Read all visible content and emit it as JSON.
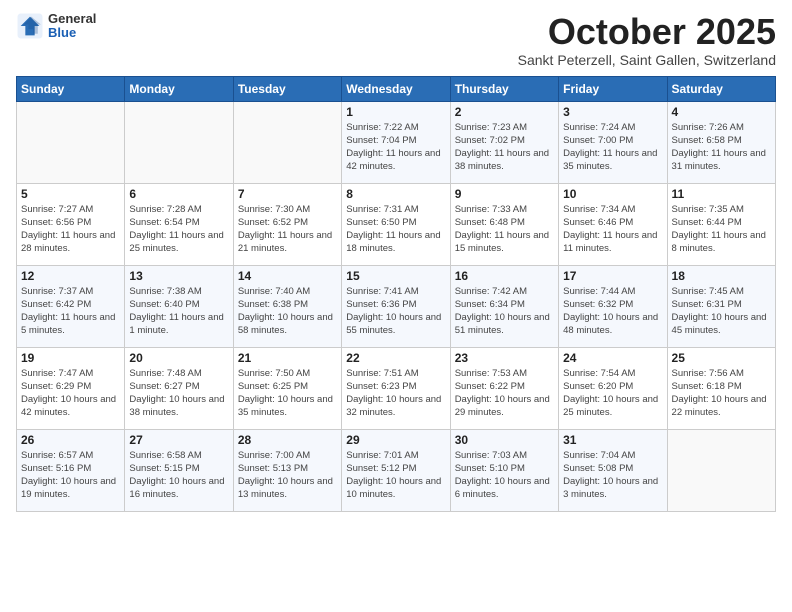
{
  "header": {
    "logo_general": "General",
    "logo_blue": "Blue",
    "month_title": "October 2025",
    "location": "Sankt Peterzell, Saint Gallen, Switzerland"
  },
  "days_of_week": [
    "Sunday",
    "Monday",
    "Tuesday",
    "Wednesday",
    "Thursday",
    "Friday",
    "Saturday"
  ],
  "weeks": [
    [
      {
        "day": "",
        "info": ""
      },
      {
        "day": "",
        "info": ""
      },
      {
        "day": "",
        "info": ""
      },
      {
        "day": "1",
        "info": "Sunrise: 7:22 AM\nSunset: 7:04 PM\nDaylight: 11 hours and 42 minutes."
      },
      {
        "day": "2",
        "info": "Sunrise: 7:23 AM\nSunset: 7:02 PM\nDaylight: 11 hours and 38 minutes."
      },
      {
        "day": "3",
        "info": "Sunrise: 7:24 AM\nSunset: 7:00 PM\nDaylight: 11 hours and 35 minutes."
      },
      {
        "day": "4",
        "info": "Sunrise: 7:26 AM\nSunset: 6:58 PM\nDaylight: 11 hours and 31 minutes."
      }
    ],
    [
      {
        "day": "5",
        "info": "Sunrise: 7:27 AM\nSunset: 6:56 PM\nDaylight: 11 hours and 28 minutes."
      },
      {
        "day": "6",
        "info": "Sunrise: 7:28 AM\nSunset: 6:54 PM\nDaylight: 11 hours and 25 minutes."
      },
      {
        "day": "7",
        "info": "Sunrise: 7:30 AM\nSunset: 6:52 PM\nDaylight: 11 hours and 21 minutes."
      },
      {
        "day": "8",
        "info": "Sunrise: 7:31 AM\nSunset: 6:50 PM\nDaylight: 11 hours and 18 minutes."
      },
      {
        "day": "9",
        "info": "Sunrise: 7:33 AM\nSunset: 6:48 PM\nDaylight: 11 hours and 15 minutes."
      },
      {
        "day": "10",
        "info": "Sunrise: 7:34 AM\nSunset: 6:46 PM\nDaylight: 11 hours and 11 minutes."
      },
      {
        "day": "11",
        "info": "Sunrise: 7:35 AM\nSunset: 6:44 PM\nDaylight: 11 hours and 8 minutes."
      }
    ],
    [
      {
        "day": "12",
        "info": "Sunrise: 7:37 AM\nSunset: 6:42 PM\nDaylight: 11 hours and 5 minutes."
      },
      {
        "day": "13",
        "info": "Sunrise: 7:38 AM\nSunset: 6:40 PM\nDaylight: 11 hours and 1 minute."
      },
      {
        "day": "14",
        "info": "Sunrise: 7:40 AM\nSunset: 6:38 PM\nDaylight: 10 hours and 58 minutes."
      },
      {
        "day": "15",
        "info": "Sunrise: 7:41 AM\nSunset: 6:36 PM\nDaylight: 10 hours and 55 minutes."
      },
      {
        "day": "16",
        "info": "Sunrise: 7:42 AM\nSunset: 6:34 PM\nDaylight: 10 hours and 51 minutes."
      },
      {
        "day": "17",
        "info": "Sunrise: 7:44 AM\nSunset: 6:32 PM\nDaylight: 10 hours and 48 minutes."
      },
      {
        "day": "18",
        "info": "Sunrise: 7:45 AM\nSunset: 6:31 PM\nDaylight: 10 hours and 45 minutes."
      }
    ],
    [
      {
        "day": "19",
        "info": "Sunrise: 7:47 AM\nSunset: 6:29 PM\nDaylight: 10 hours and 42 minutes."
      },
      {
        "day": "20",
        "info": "Sunrise: 7:48 AM\nSunset: 6:27 PM\nDaylight: 10 hours and 38 minutes."
      },
      {
        "day": "21",
        "info": "Sunrise: 7:50 AM\nSunset: 6:25 PM\nDaylight: 10 hours and 35 minutes."
      },
      {
        "day": "22",
        "info": "Sunrise: 7:51 AM\nSunset: 6:23 PM\nDaylight: 10 hours and 32 minutes."
      },
      {
        "day": "23",
        "info": "Sunrise: 7:53 AM\nSunset: 6:22 PM\nDaylight: 10 hours and 29 minutes."
      },
      {
        "day": "24",
        "info": "Sunrise: 7:54 AM\nSunset: 6:20 PM\nDaylight: 10 hours and 25 minutes."
      },
      {
        "day": "25",
        "info": "Sunrise: 7:56 AM\nSunset: 6:18 PM\nDaylight: 10 hours and 22 minutes."
      }
    ],
    [
      {
        "day": "26",
        "info": "Sunrise: 6:57 AM\nSunset: 5:16 PM\nDaylight: 10 hours and 19 minutes."
      },
      {
        "day": "27",
        "info": "Sunrise: 6:58 AM\nSunset: 5:15 PM\nDaylight: 10 hours and 16 minutes."
      },
      {
        "day": "28",
        "info": "Sunrise: 7:00 AM\nSunset: 5:13 PM\nDaylight: 10 hours and 13 minutes."
      },
      {
        "day": "29",
        "info": "Sunrise: 7:01 AM\nSunset: 5:12 PM\nDaylight: 10 hours and 10 minutes."
      },
      {
        "day": "30",
        "info": "Sunrise: 7:03 AM\nSunset: 5:10 PM\nDaylight: 10 hours and 6 minutes."
      },
      {
        "day": "31",
        "info": "Sunrise: 7:04 AM\nSunset: 5:08 PM\nDaylight: 10 hours and 3 minutes."
      },
      {
        "day": "",
        "info": ""
      }
    ]
  ]
}
